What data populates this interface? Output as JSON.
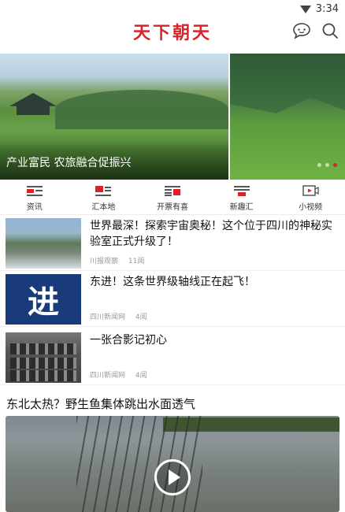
{
  "status": {
    "time": "3:34"
  },
  "header": {
    "title": "天下朝天",
    "brand_color": "#d8232a",
    "icons": [
      "chat-bubble-icon",
      "search-icon"
    ]
  },
  "banner": {
    "caption": "产业富民 农旅融合促振兴",
    "dots": 3,
    "active_dot": 3
  },
  "nav": [
    {
      "label": "资讯",
      "icon": "news-icon"
    },
    {
      "label": "汇本地",
      "icon": "local-icon"
    },
    {
      "label": "开票有喜",
      "icon": "ticket-icon"
    },
    {
      "label": "新趣汇",
      "icon": "fun-icon"
    },
    {
      "label": "小视频",
      "icon": "video-icon"
    }
  ],
  "articles": [
    {
      "title": "世界最深！探索宇宙奥秘！这个位于四川的神秘实验室正式升级了！",
      "source": "川报观察",
      "time": "11阅"
    },
    {
      "title": "东进！这条世界级轴线正在起飞！",
      "source": "四川新闻网",
      "time": "4阅",
      "thumb_text": "进"
    },
    {
      "title": "一张合影记初心",
      "source": "四川新闻网",
      "time": "4阅"
    }
  ],
  "video": {
    "title": "东北太热？野生鱼集体跳出水面透气"
  }
}
